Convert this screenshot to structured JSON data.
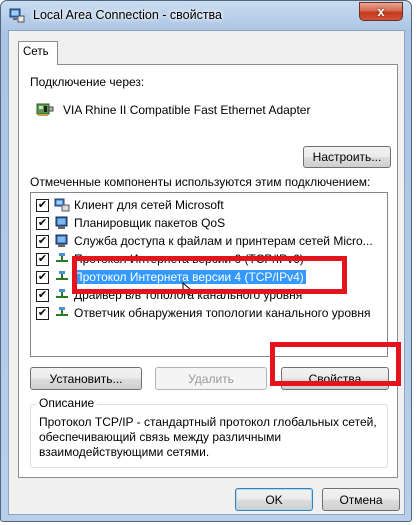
{
  "window": {
    "title": "Local Area Connection - свойства",
    "close_glyph": "x"
  },
  "tabs": [
    {
      "label": "Сеть",
      "active": true
    }
  ],
  "connection": {
    "label": "Подключение через:",
    "adapter_name": "VIA Rhine II Compatible Fast Ethernet Adapter",
    "configure_button": "Настроить..."
  },
  "components": {
    "label": "Отмеченные компоненты используются этим подключением:",
    "items": [
      {
        "label": "Клиент для сетей Microsoft",
        "checked": true,
        "icon": "network-client-icon",
        "selected": false
      },
      {
        "label": "Планировщик пакетов QoS",
        "checked": true,
        "icon": "qos-scheduler-icon",
        "selected": false
      },
      {
        "label": "Служба доступа к файлам и принтерам сетей Micro...",
        "checked": true,
        "icon": "file-printer-sharing-icon",
        "selected": false
      },
      {
        "label": "Протокол Интернета версии 6 (TCP/IPv6)",
        "checked": true,
        "icon": "protocol-icon",
        "selected": false
      },
      {
        "label": "Протокол Интернета версии 4 (TCP/IPv4)",
        "checked": true,
        "icon": "protocol-icon",
        "selected": true
      },
      {
        "label": "Драйвер в/в тополога канального уровня",
        "checked": true,
        "icon": "protocol-icon",
        "selected": false
      },
      {
        "label": "Ответчик обнаружения топологии канального уровня",
        "checked": true,
        "icon": "protocol-icon",
        "selected": false
      }
    ]
  },
  "actions": {
    "install": "Установить...",
    "uninstall": "Удалить",
    "properties": "Свойства"
  },
  "description": {
    "legend": "Описание",
    "text": "Протокол TCP/IP - стандартный протокол глобальных сетей, обеспечивающий связь между различными взаимодействующими сетями."
  },
  "footer": {
    "ok": "OK",
    "cancel": "Отмена"
  },
  "colors": {
    "highlight": "#e5141c",
    "selection": "#3399ff"
  }
}
